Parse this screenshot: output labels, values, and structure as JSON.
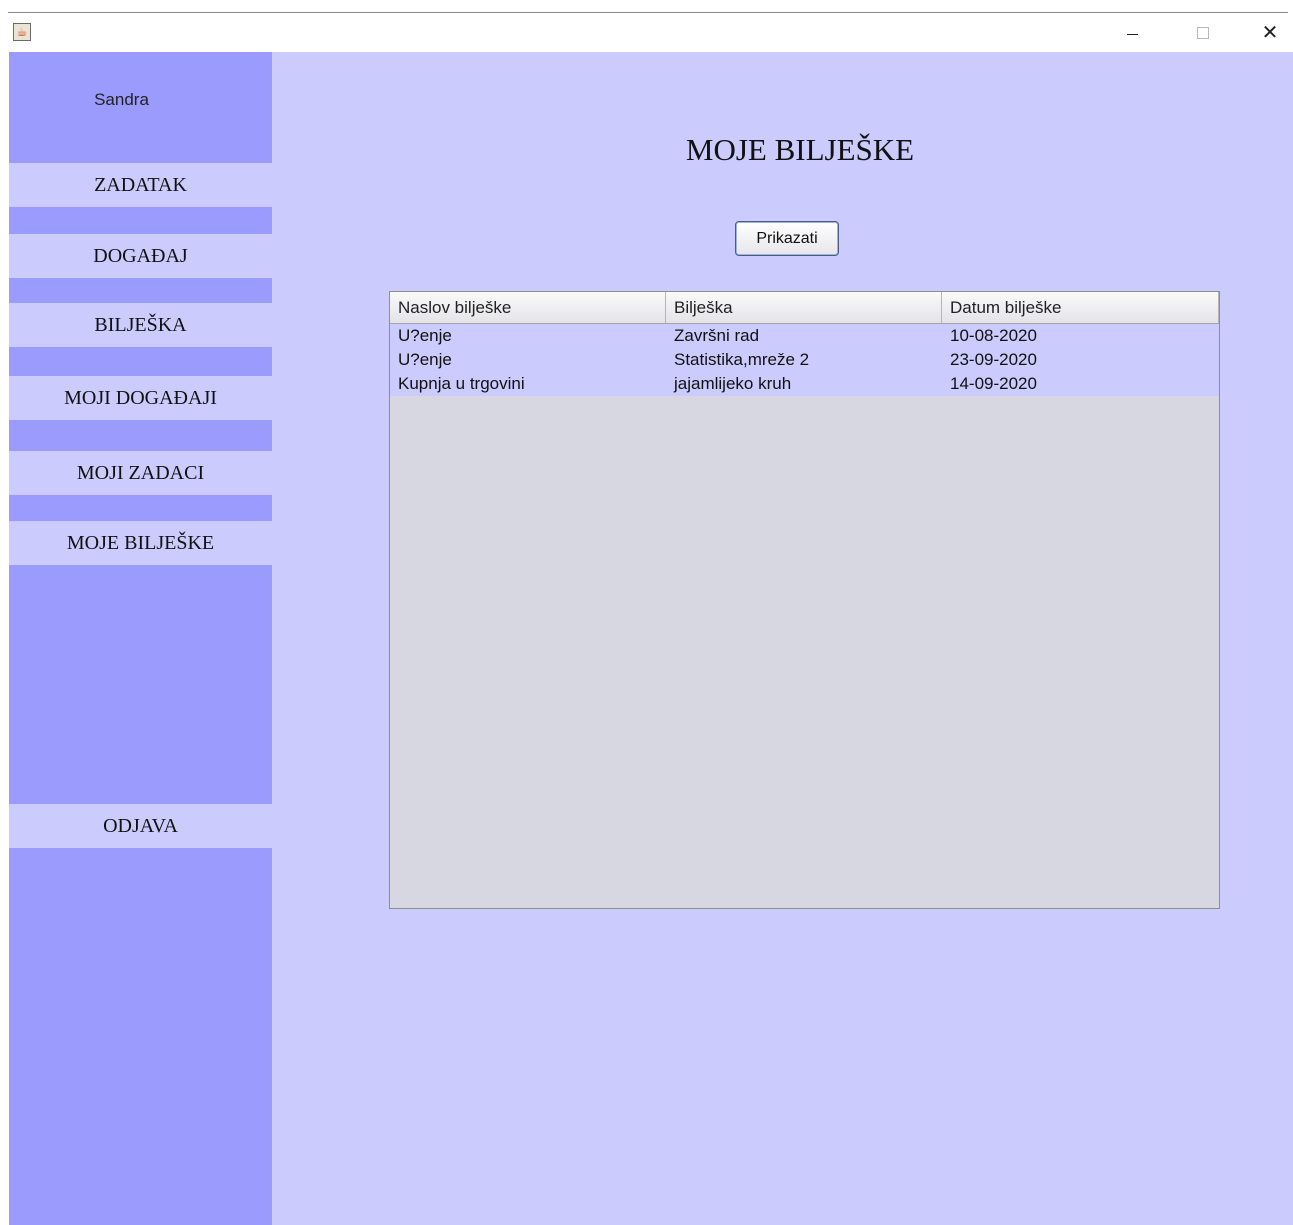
{
  "window": {
    "minimize_label": "–",
    "close_label": "✕"
  },
  "sidebar": {
    "user_name": "Sandra",
    "items": [
      {
        "label": "ZADATAK"
      },
      {
        "label": "DOGAĐAJ"
      },
      {
        "label": "BILJEŠKA"
      },
      {
        "label": "MOJI DOGAĐAJI"
      },
      {
        "label": "MOJI ZADACI"
      },
      {
        "label": "MOJE BILJEŠKE"
      }
    ],
    "logout_label": "ODJAVA"
  },
  "main": {
    "title": "MOJE BILJEŠKE",
    "show_button_label": "Prikazati",
    "table": {
      "columns": [
        "Naslov bilješke",
        "Bilješka",
        "Datum bilješke"
      ],
      "rows": [
        [
          "U?enje",
          "Završni rad",
          "10-08-2020"
        ],
        [
          "U?enje",
          "Statistika,mreže 2",
          "23-09-2020"
        ],
        [
          "Kupnja u trgovini",
          "jajamlijeko kruh",
          "14-09-2020"
        ]
      ]
    }
  },
  "colors": {
    "sidebar_bg": "#9b9bfe",
    "content_bg": "#cbcbfd",
    "table_empty_bg": "#d6d7e0"
  }
}
